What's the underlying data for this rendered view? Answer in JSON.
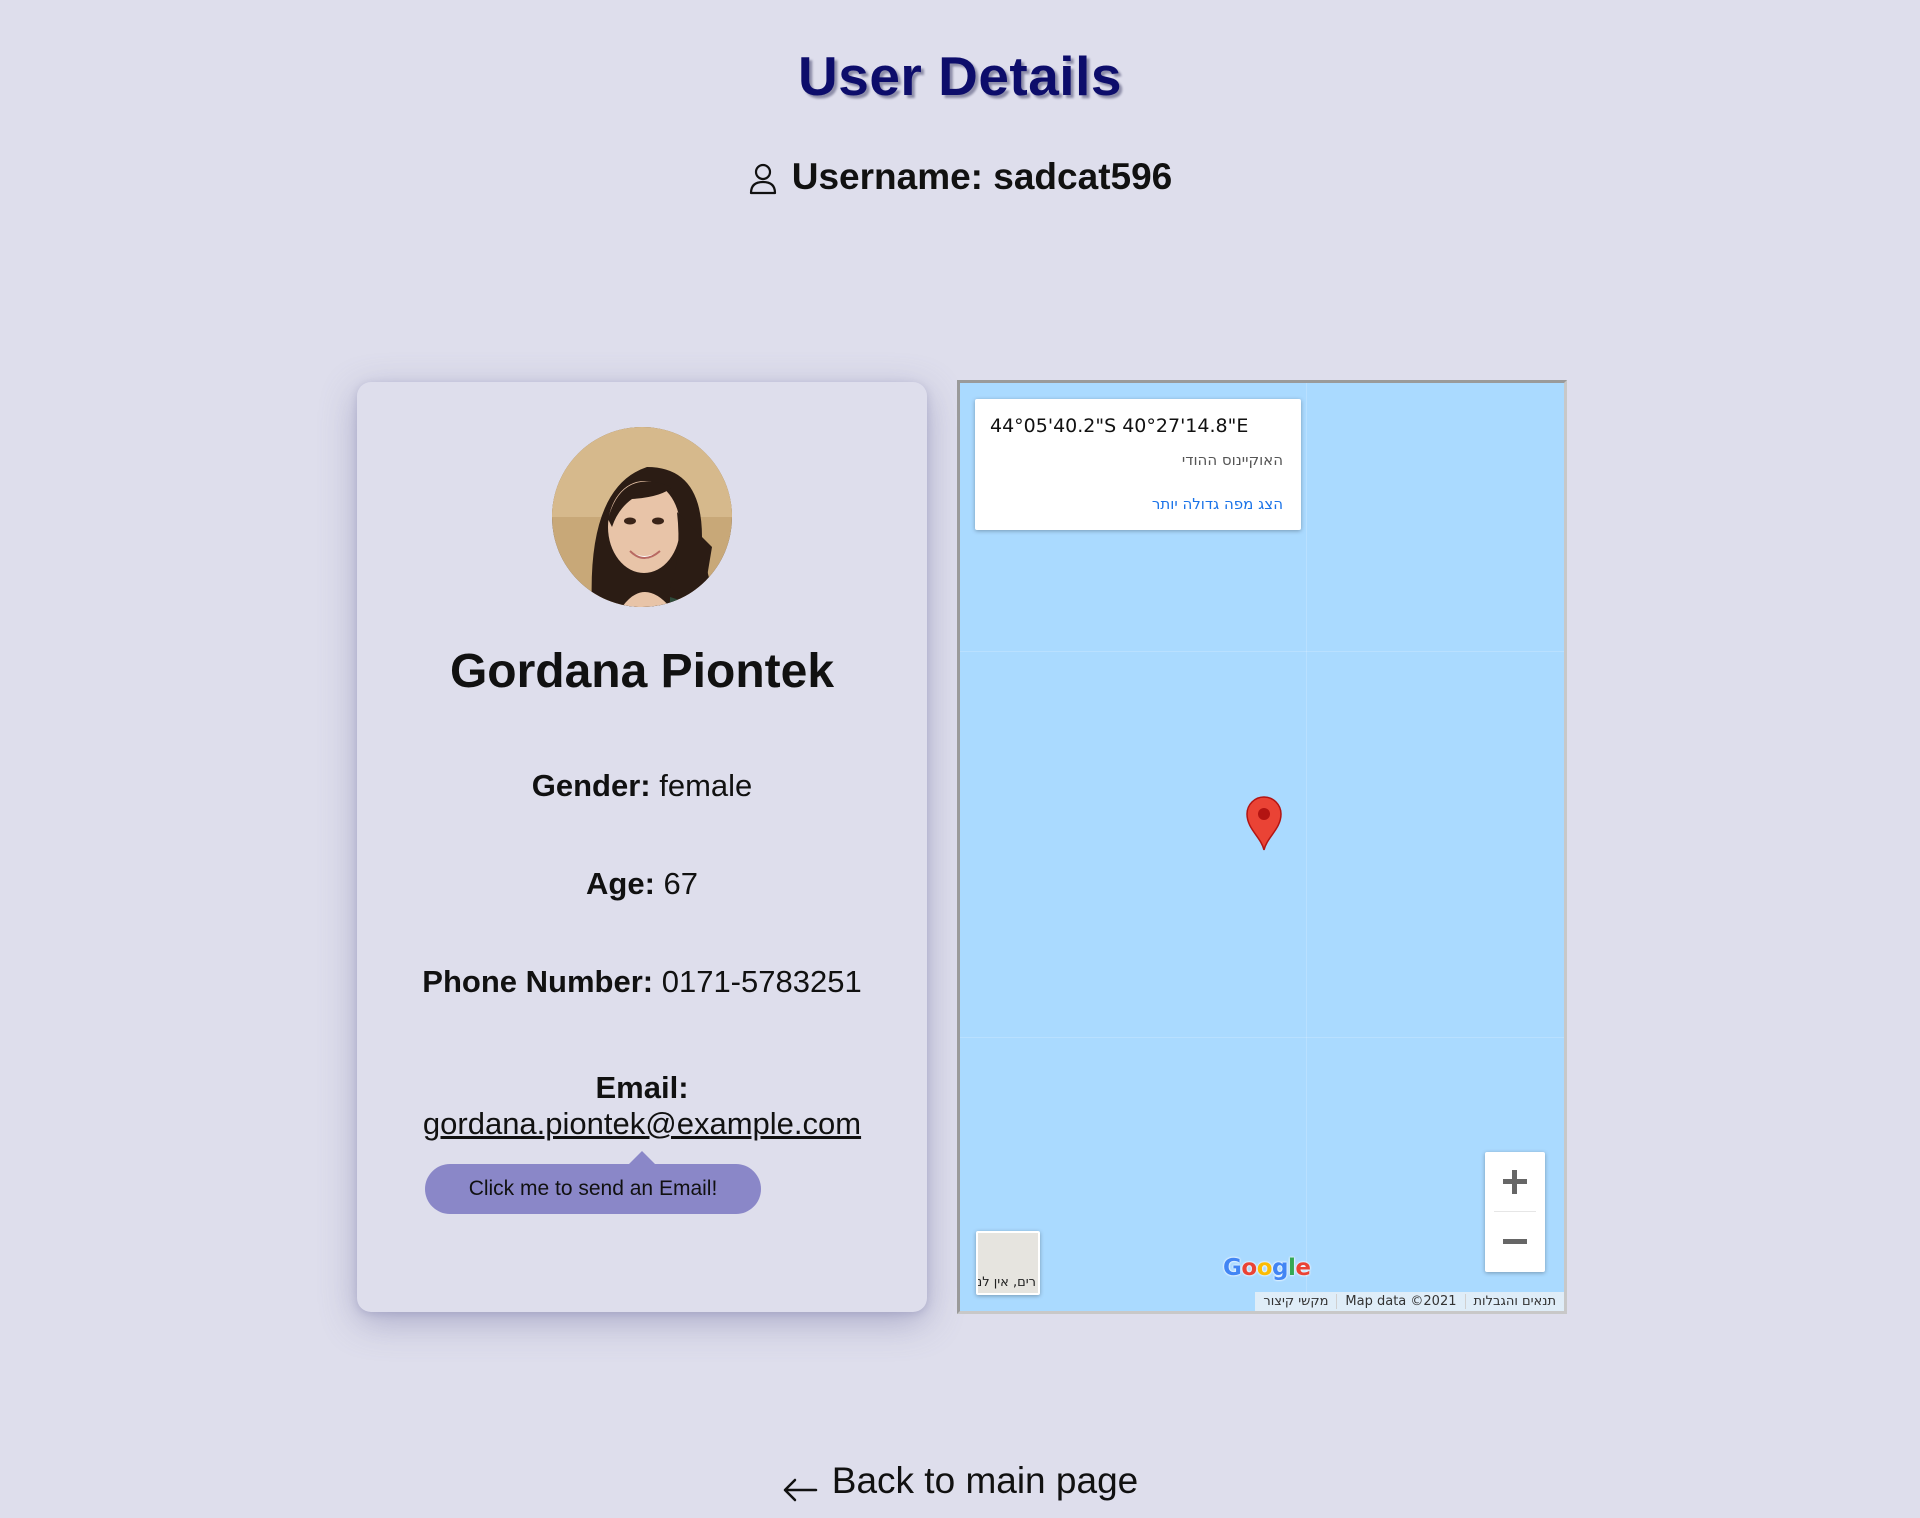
{
  "page": {
    "title": "User Details",
    "username_line": "Username: sadcat596",
    "background_color": "#dedeec",
    "title_color": "#0d0d6b"
  },
  "user": {
    "full_name": "Gordana Piontek",
    "gender_label": "Gender:",
    "gender": "female",
    "age_label": "Age:",
    "age": "67",
    "phone_label": "Phone Number:",
    "phone": "0171-5783251",
    "email_label": "Email:",
    "email": "gordana.piontek@example.com",
    "email_tooltip": "Click me to send an Email!",
    "tooltip_color": "#8a87c8"
  },
  "map": {
    "coordinates": "44°05'40.2\"S 40°27'14.8\"E",
    "place_name": "האוקיינוס ההודי",
    "larger_map_link": "הצג מפה גדולה יותר",
    "zoom_in_icon": "plus-icon",
    "zoom_out_icon": "minus-icon",
    "layer_toggle_label": "רים, אין לנ",
    "google_logo": "Google",
    "attribution": {
      "terms": "תנאים והגבלות",
      "map_data": "Map data ©2021",
      "shortcuts": "מקשי קיצור"
    },
    "water_color": "#aadaff",
    "marker_color": "#ea4335"
  },
  "navigation": {
    "back_label": "Back to main page",
    "back_icon": "arrow-left-icon"
  }
}
